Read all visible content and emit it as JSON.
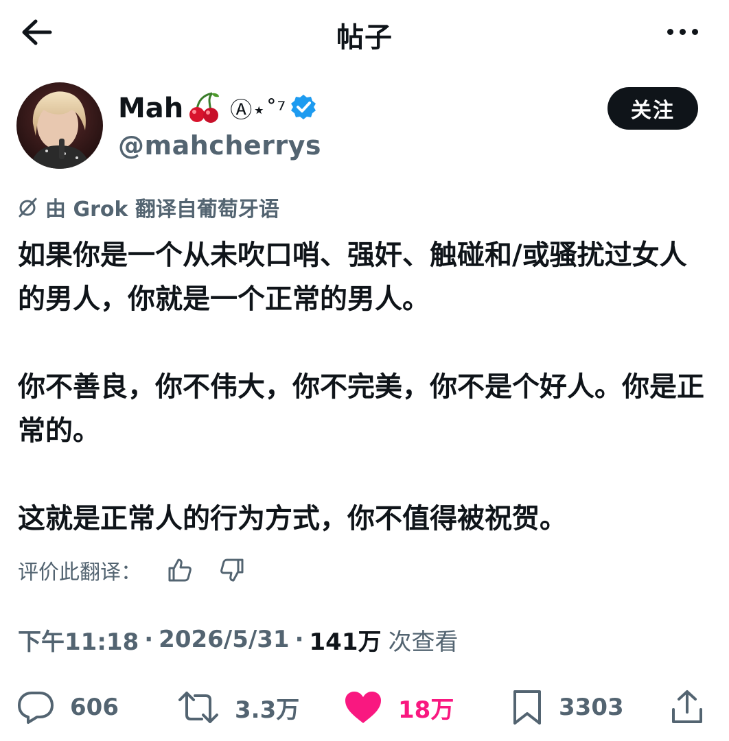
{
  "header": {
    "title": "帖子",
    "back_icon": "arrow-left-icon",
    "more_icon": "more-horizontal-icon"
  },
  "author": {
    "display_name": "Mah",
    "name_emoji": "🍒",
    "name_deco": "Ⓐ⋆˚⁷",
    "handle": "@mahcherrys",
    "verified": true,
    "verified_color": "#1d9bf0",
    "follow_label": "关注"
  },
  "translation": {
    "label": "由 Grok 翻译自葡萄牙语",
    "rate_label": "评价此翻译："
  },
  "post": {
    "paragraphs": [
      "如果你是一个从未吹口哨、强奸、触碰和/或骚扰过女人的男人，你就是一个正常的男人。",
      "你不善良，你不伟大，你不完美，你不是个好人。你是正常的。",
      "这就是正常人的行为方式，你不值得被祝贺。"
    ]
  },
  "meta": {
    "time": "下午11:18",
    "separator": "·",
    "date": "2026/5/31",
    "views_count": "141万",
    "views_label": "次查看"
  },
  "actions": {
    "replies": "606",
    "reposts": "3.3万",
    "likes": "18万",
    "bookmarks": "3303"
  },
  "colors": {
    "text": "#0f1419",
    "secondary": "#536471",
    "like": "#f91880",
    "follow_bg": "#0f1419"
  }
}
